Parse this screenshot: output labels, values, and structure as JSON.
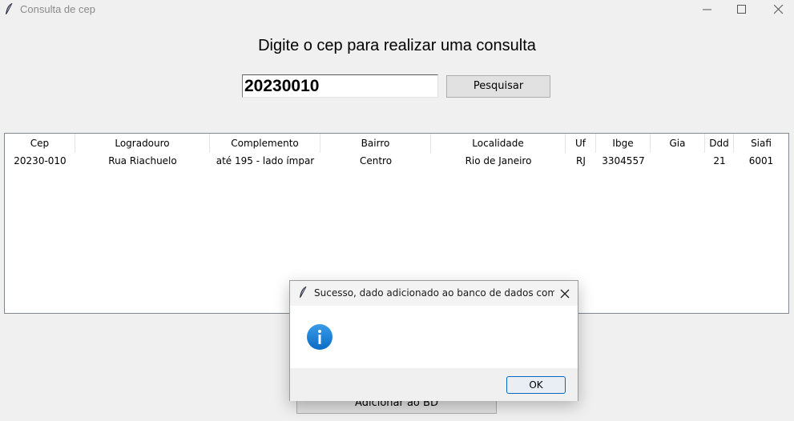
{
  "window": {
    "title": "Consulta de cep",
    "icon": "feather-icon"
  },
  "main": {
    "heading": "Digite o cep para realizar uma consulta",
    "cep_value": "20230010",
    "search_label": "Pesquisar",
    "add_label": "Adicionar ao BD"
  },
  "table": {
    "headers": [
      "Cep",
      "Logradouro",
      "Complemento",
      "Bairro",
      "Localidade",
      "Uf",
      "Ibge",
      "Gia",
      "Ddd",
      "Siafi"
    ],
    "rows": [
      [
        "20230-010",
        "Rua Riachuelo",
        "até 195 - lado ímpar",
        "Centro",
        "Rio de Janeiro",
        "RJ",
        "3304557",
        "",
        "21",
        "6001"
      ]
    ]
  },
  "dialog": {
    "title": "Sucesso, dado adicionado ao banco de dados com su...",
    "icon": "info-icon",
    "ok_label": "OK"
  },
  "colors": {
    "info_blue": "#1a7fd4",
    "ok_border": "#0067c0"
  }
}
